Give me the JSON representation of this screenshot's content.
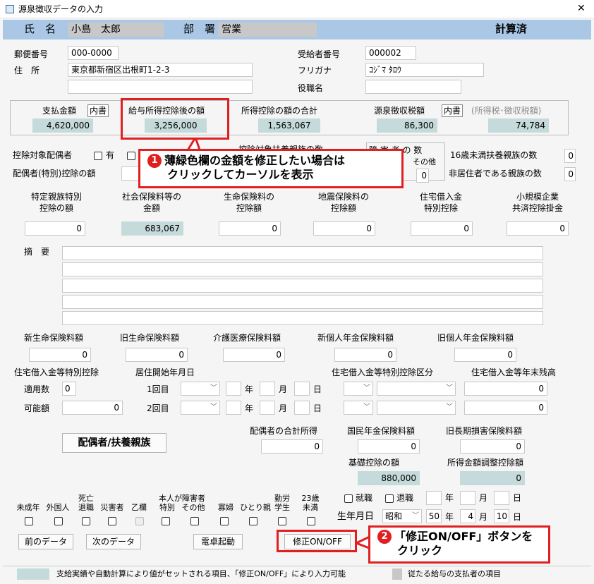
{
  "window": {
    "title": "源泉徴収データの入力",
    "close": "✕"
  },
  "header": {
    "name_label": "氏　名",
    "name_value": "小島　太郎",
    "dept_label": "部　署",
    "dept_value": "営業",
    "status": "計算済"
  },
  "address": {
    "postal_label": "郵便番号",
    "postal_value": "000-0000",
    "address_label": "住　所",
    "address_value": "東京都新宿区出根町1-2-3",
    "address2_value": "",
    "recipient_no_label": "受給者番号",
    "recipient_no_value": "000002",
    "furigana_label": "フリガナ",
    "furigana_value": "ｺｼﾞﾏ ﾀﾛｳ",
    "position_label": "役職名",
    "position_value": ""
  },
  "amounts": {
    "pay_label": "支払金額",
    "pay_badge": "内書",
    "pay_value": "4,620,000",
    "after_ded_label": "給与所得控除後の額",
    "after_ded_value": "3,256,000",
    "total_ded_label": "所得控除の額の合計",
    "total_ded_value": "1,563,067",
    "tax_label": "源泉徴収税額",
    "tax_badge": "内書",
    "tax_value": "86,300",
    "tax_paren_label": "(所得税･徴収税額)",
    "tax_paren_value": "74,784"
  },
  "dependents": {
    "spouse_target_label": "控除対象配偶者",
    "has_label": "有",
    "spouse_special_label": "配偶者(特別)控除の額",
    "dep_count_label": "控除対象扶養親族の数",
    "disabled_label": "障 害 者 の 数",
    "disabled_other_label": "その他",
    "disabled_other_value": "0",
    "under16_label": "16歳未満扶養親族の数",
    "under16_value": "0",
    "nonres_label": "非居住者である親族の数",
    "nonres_value": "0"
  },
  "deductions_row": {
    "specific_label1": "特定親族特別",
    "specific_label2": "控除の額",
    "specific_value": "0",
    "social_label1": "社会保険料等の",
    "social_label2": "金額",
    "social_value": "683,067",
    "life_label1": "生命保険料の",
    "life_label2": "控除額",
    "life_value": "0",
    "quake_label1": "地震保険料の",
    "quake_label2": "控除額",
    "quake_value": "0",
    "housing_label1": "住宅借入金",
    "housing_label2": "特別控除",
    "housing_value": "0",
    "small_biz_label1": "小規模企業",
    "small_biz_label2": "共済控除掛金",
    "small_biz_value": "0"
  },
  "summary": {
    "label": "摘　要",
    "lines": [
      "",
      "",
      "",
      "",
      "",
      ""
    ]
  },
  "insurance": {
    "new_life_label": "新生命保険料額",
    "new_life_value": "0",
    "old_life_label": "旧生命保険料額",
    "old_life_value": "0",
    "care_label": "介護医療保険料額",
    "care_value": "0",
    "new_pension_label": "新個人年金保険料額",
    "new_pension_value": "0",
    "old_pension_label": "旧個人年金保険料額",
    "old_pension_value": "0"
  },
  "housing": {
    "title": "住宅借入金等特別控除",
    "start_title": "居住開始年月日",
    "apply_label": "適用数",
    "apply_value": "0",
    "possible_label": "可能額",
    "possible_value": "0",
    "first_label": "1回目",
    "second_label": "2回目",
    "year": "年",
    "month": "月",
    "day": "日",
    "class_title": "住宅借入金等特別控除区分",
    "balance_title": "住宅借入金等年末残高",
    "balance1": "0",
    "balance2": "0"
  },
  "spouse": {
    "button_label": "配偶者/扶養親族",
    "total_income_label": "配偶者の合計所得",
    "total_income_value": "0",
    "national_pension_label": "国民年金保険料額",
    "national_pension_value": "0",
    "old_longterm_label": "旧長期損害保険料額",
    "old_longterm_value": "0",
    "basic_ded_label": "基礎控除の額",
    "basic_ded_value": "880,000",
    "adjust_label": "所得金額調整控除額",
    "adjust_value": "0"
  },
  "status_checks": {
    "minor": "未成年",
    "foreigner": "外国人",
    "death_retire1": "死亡",
    "death_retire2": "退職",
    "disaster": "災害者",
    "otsu": "乙欄",
    "self_disabled1": "本人が障害者",
    "special": "特別",
    "other": "その他",
    "widow": "寡婦",
    "single_parent": "ひとり親",
    "student1": "勤労",
    "student2": "学生",
    "under23_1": "23歳",
    "under23_2": "未満"
  },
  "employment": {
    "hire_label": "就職",
    "retire_label": "退職",
    "year": "年",
    "month": "月",
    "day": "日",
    "birth_label": "生年月日",
    "era": "昭和",
    "birth_year": "50",
    "birth_month": "4",
    "birth_day": "10"
  },
  "buttons": {
    "prev": "前のデータ",
    "next": "次のデータ",
    "calc": "電卓起動",
    "toggle_edit": "修正ON/OFF"
  },
  "callouts": {
    "c1_num": "1",
    "c1_line1": "薄緑色欄の金額を修正したい場合は",
    "c1_line2": "クリックしてカーソルを表示",
    "c2_num": "2",
    "c2_line1": "「修正ON/OFF」ボタンを",
    "c2_line2": "クリック"
  },
  "legend": {
    "auto_text": "支給実績や自動計算により値がセットされる項目、「修正ON/OFF」により入力可能",
    "main_text": "従たる給与の支払者の項目"
  },
  "colors": {
    "header_bar": "#aac8e6",
    "auto_field": "#c5dada",
    "main_field": "#c8c8c8",
    "callout": "#e02020"
  }
}
